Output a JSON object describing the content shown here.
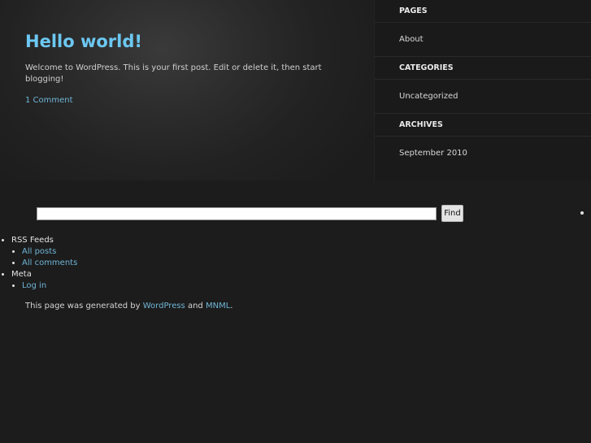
{
  "post": {
    "title": "Hello world!",
    "body": "Welcome to WordPress. This is your first post. Edit or delete it, then start blogging!",
    "comments_link": "1 Comment"
  },
  "sidebar": {
    "sections": [
      {
        "heading": "PAGES",
        "item": "About"
      },
      {
        "heading": "CATEGORIES",
        "item": "Uncategorized"
      },
      {
        "heading": "ARCHIVES",
        "item": "September 2010"
      }
    ]
  },
  "search": {
    "value": "",
    "button_label": "Find"
  },
  "footer": {
    "rss_heading": "RSS Feeds",
    "rss_items": [
      "All posts",
      "All comments"
    ],
    "meta_heading": "Meta",
    "meta_items": [
      "Log in"
    ],
    "credit_prefix": "This page was generated by",
    "credit_link1": "WordPress",
    "credit_mid": "and",
    "credit_link2": "MNML",
    "credit_suffix": "."
  }
}
